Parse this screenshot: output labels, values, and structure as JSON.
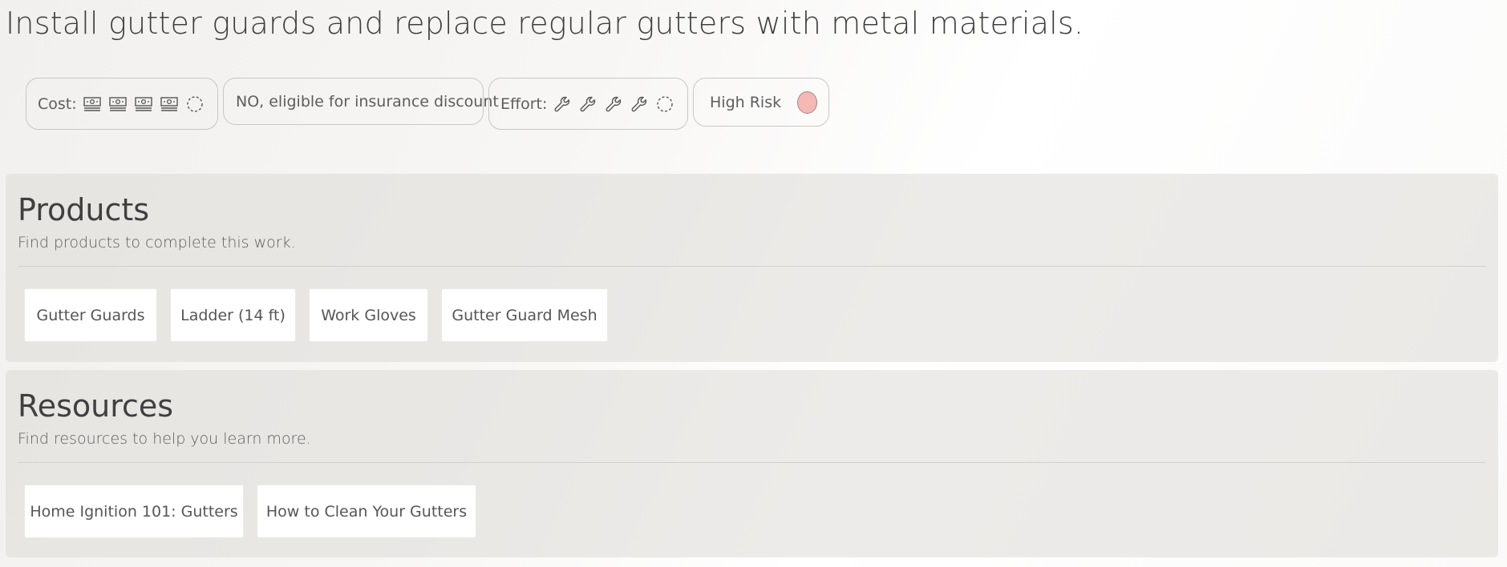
{
  "title": "Install gutter guards and replace regular gutters with metal materials.",
  "badges": {
    "cost": {
      "label": "Cost:",
      "filled": 4,
      "max": 5,
      "icon_filled": "money-icon",
      "icon_empty": "dashed-circle-icon"
    },
    "insurance": {
      "label": "NO, eligible for insurance discount"
    },
    "effort": {
      "label": "Effort:",
      "filled": 4,
      "max": 5,
      "icon_filled": "wrench-icon",
      "icon_empty": "dashed-circle-icon"
    },
    "risk": {
      "label": "High Risk",
      "color": "#f5b8b3"
    }
  },
  "products": {
    "heading": "Products",
    "subtitle": "Find products to complete this work.",
    "items": [
      "Gutter Guards",
      "Ladder (14 ft)",
      "Work Gloves",
      "Gutter Guard Mesh"
    ]
  },
  "resources": {
    "heading": "Resources",
    "subtitle": "Find resources to help you learn more.",
    "items": [
      "Home Ignition 101: Gutters",
      "How to Clean Your Gutters"
    ]
  }
}
